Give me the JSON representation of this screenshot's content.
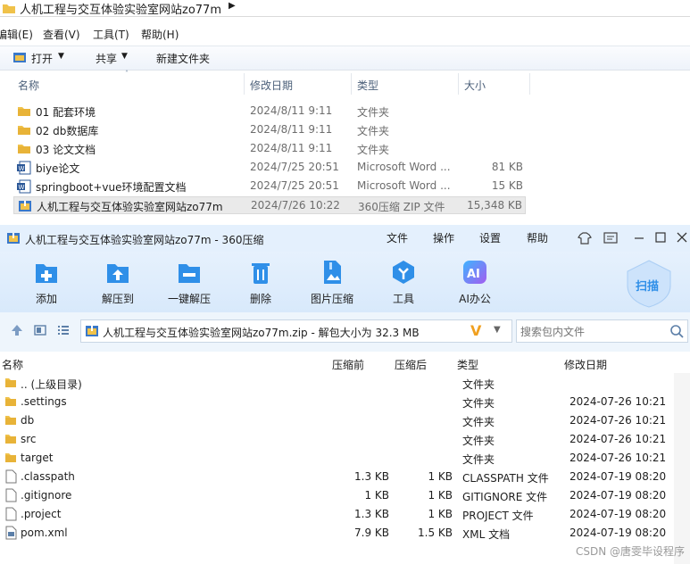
{
  "explorer": {
    "address_path": "人机工程与交互体验实验室网站zo77m",
    "menus": [
      "编辑(E)",
      "查看(V)",
      "工具(T)",
      "帮助(H)"
    ],
    "commands": [
      "打开",
      "共享",
      "新建文件夹"
    ],
    "columns": [
      "名称",
      "修改日期",
      "类型",
      "大小"
    ],
    "files": [
      {
        "name": "01 配套环境",
        "date": "2024/8/11 9:11",
        "type": "文件夹",
        "size": "",
        "icon": "folder-icon"
      },
      {
        "name": "02 db数据库",
        "date": "2024/8/11 9:11",
        "type": "文件夹",
        "size": "",
        "icon": "folder-icon"
      },
      {
        "name": "03 论文文档",
        "date": "2024/8/11 9:11",
        "type": "文件夹",
        "size": "",
        "icon": "folder-icon"
      },
      {
        "name": "biye论文",
        "date": "2024/7/25 20:51",
        "type": "Microsoft Word ...",
        "size": "81 KB",
        "icon": "word-icon"
      },
      {
        "name": "springboot+vue环境配置文档",
        "date": "2024/7/25 20:51",
        "type": "Microsoft Word ...",
        "size": "15 KB",
        "icon": "word-icon"
      },
      {
        "name": "人机工程与交互体验实验室网站zo77m",
        "date": "2024/7/26 10:22",
        "type": "360压缩 ZIP 文件",
        "size": "15,348 KB",
        "icon": "zip-icon"
      }
    ]
  },
  "zip": {
    "title": "人机工程与交互体验实验室网站zo77m - 360压缩",
    "menus": [
      "文件",
      "操作",
      "设置",
      "帮助"
    ],
    "tools": [
      {
        "label": "添加",
        "color": "#2f8fe8",
        "icon": "add-icon"
      },
      {
        "label": "解压到",
        "color": "#2f8fe8",
        "icon": "extract-to-icon"
      },
      {
        "label": "一键解压",
        "color": "#2f8fe8",
        "icon": "one-click-extract-icon"
      },
      {
        "label": "删除",
        "color": "#2f8fe8",
        "icon": "delete-icon"
      },
      {
        "label": "图片压缩",
        "color": "#2f8fe8",
        "icon": "image-compress-icon"
      },
      {
        "label": "工具",
        "color": "#2f8fe8",
        "icon": "tools-icon"
      },
      {
        "label": "AI办公",
        "color": "#8e5cf0",
        "icon": "ai-office-icon"
      }
    ],
    "scan_label": "扫描",
    "address": "人机工程与交互体验实验室网站zo77m.zip - 解包大小为 32.3 MB",
    "search_placeholder": "搜索包内文件",
    "columns": [
      "名称",
      "压缩前",
      "压缩后",
      "类型",
      "修改日期"
    ],
    "rows": [
      {
        "name": ".. (上级目录)",
        "orig": "",
        "comp": "",
        "type": "文件夹",
        "date": "",
        "icon": "folder-icon"
      },
      {
        "name": ".settings",
        "orig": "",
        "comp": "",
        "type": "文件夹",
        "date": "2024-07-26 10:21",
        "icon": "folder-icon"
      },
      {
        "name": "db",
        "orig": "",
        "comp": "",
        "type": "文件夹",
        "date": "2024-07-26 10:21",
        "icon": "folder-icon"
      },
      {
        "name": "src",
        "orig": "",
        "comp": "",
        "type": "文件夹",
        "date": "2024-07-26 10:21",
        "icon": "folder-icon"
      },
      {
        "name": "target",
        "orig": "",
        "comp": "",
        "type": "文件夹",
        "date": "2024-07-26 10:21",
        "icon": "folder-icon"
      },
      {
        "name": ".classpath",
        "orig": "1.3 KB",
        "comp": "1 KB",
        "type": "CLASSPATH 文件",
        "date": "2024-07-19 08:20",
        "icon": "file-icon"
      },
      {
        "name": ".gitignore",
        "orig": "1 KB",
        "comp": "1 KB",
        "type": "GITIGNORE 文件",
        "date": "2024-07-19 08:20",
        "icon": "file-icon"
      },
      {
        "name": ".project",
        "orig": "1.3 KB",
        "comp": "1 KB",
        "type": "PROJECT 文件",
        "date": "2024-07-19 08:20",
        "icon": "file-icon"
      },
      {
        "name": "pom.xml",
        "orig": "7.9 KB",
        "comp": "1.5 KB",
        "type": "XML 文档",
        "date": "2024-07-19 08:20",
        "icon": "xml-file-icon"
      }
    ]
  },
  "watermark": "CSDN @唐雯毕设程序",
  "colors": {
    "folder": "#f0c24a",
    "word": "#2b5797",
    "zip_titlebar": "#e4f0fd",
    "toolbar_blue": "#2f8fe8"
  }
}
